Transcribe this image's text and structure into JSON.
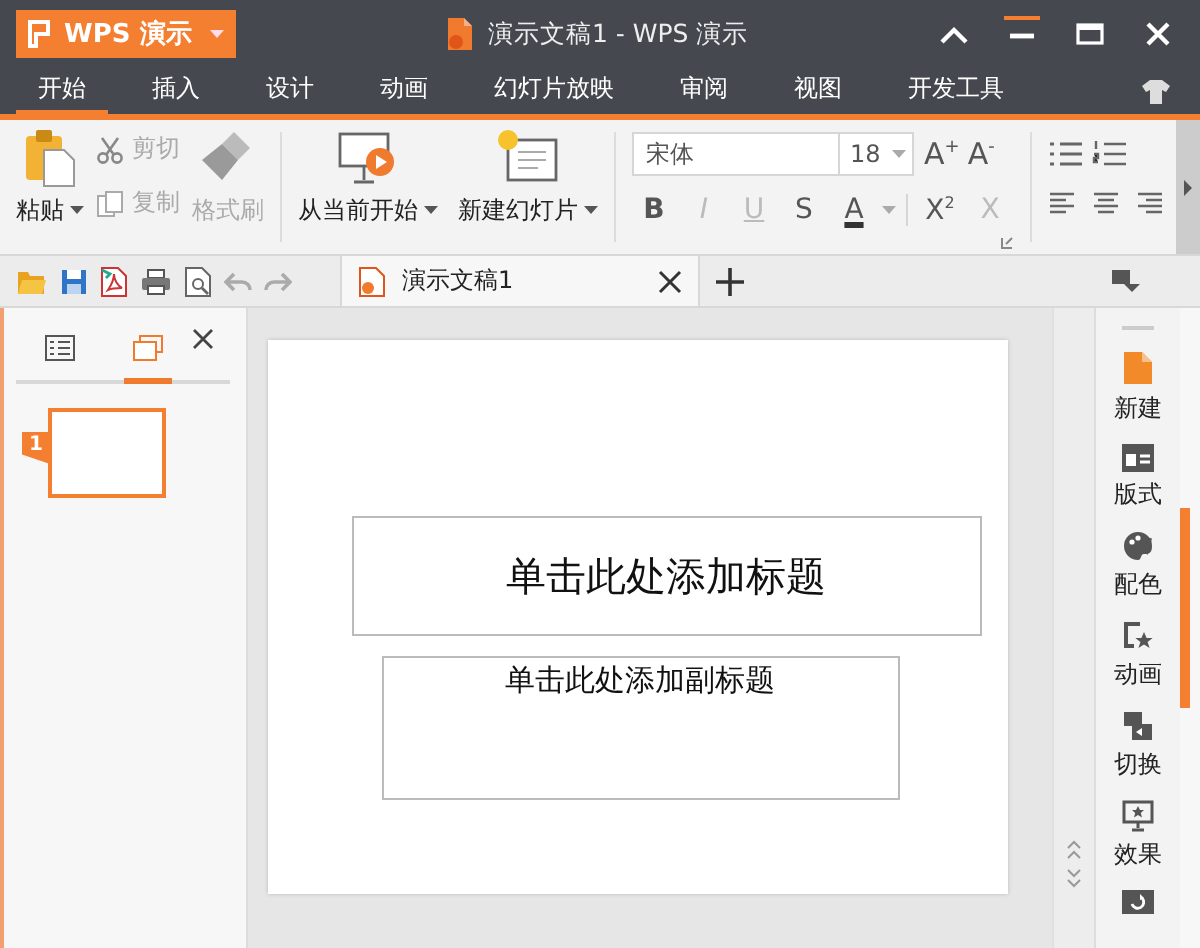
{
  "app_menu": {
    "label": "WPS 演示"
  },
  "window": {
    "title": "演示文稿1 - WPS 演示"
  },
  "menu_tabs": [
    {
      "label": "开始",
      "selected": true
    },
    {
      "label": "插入",
      "selected": false
    },
    {
      "label": "设计",
      "selected": false
    },
    {
      "label": "动画",
      "selected": false
    },
    {
      "label": "幻灯片放映",
      "selected": false
    },
    {
      "label": "审阅",
      "selected": false
    },
    {
      "label": "视图",
      "selected": false
    },
    {
      "label": "开发工具",
      "selected": false
    }
  ],
  "ribbon": {
    "paste": {
      "label": "粘贴",
      "disabled": false
    },
    "small_buttons": [
      {
        "label": "剪切",
        "kind": "cut",
        "disabled": true
      },
      {
        "label": "复制",
        "kind": "copy",
        "disabled": true
      }
    ],
    "format_painter": {
      "label": "格式刷",
      "disabled": true
    },
    "slide_buttons": [
      {
        "label": "从当前开始",
        "kind": "play"
      },
      {
        "label": "新建幻灯片",
        "kind": "new-slide"
      }
    ],
    "font": {
      "value": "宋体"
    },
    "font_size": {
      "value": "18"
    },
    "size_buttons": [
      "A$^{+}$",
      "A$^{-}$"
    ],
    "format_buttons": [
      {
        "label": "B",
        "kind": "bold",
        "disabled": false
      },
      {
        "label": "I",
        "kind": "italic",
        "disabled": true
      },
      {
        "label": "U",
        "kind": "underline",
        "disabled": true
      },
      {
        "label": "S",
        "kind": "shadow",
        "disabled": false
      },
      {
        "label": "A",
        "kind": "color",
        "disabled": false
      },
      {
        "label": "X$^{2}$",
        "kind": "super",
        "disabled": false
      },
      {
        "label": "X",
        "kind": "clear",
        "disabled": true
      }
    ]
  },
  "document_tabs": [
    {
      "label": "演示文稿1",
      "selected": true
    }
  ],
  "slide_panel": {
    "view_tabs": [
      {
        "kind": "outline",
        "selected": false
      },
      {
        "kind": "slides",
        "selected": true
      }
    ],
    "thumbnails": [
      {
        "number": "1",
        "selected": true
      }
    ]
  },
  "slide": {
    "title_placeholder": "单击此处添加标题",
    "subtitle_placeholder": "单击此处添加副标题"
  },
  "task_pane": [
    {
      "label": "新建",
      "kind": "new"
    },
    {
      "label": "版式",
      "kind": "layout"
    },
    {
      "label": "配色",
      "kind": "palette"
    },
    {
      "label": "动画",
      "kind": "animation"
    },
    {
      "label": "切换",
      "kind": "transition"
    },
    {
      "label": "效果",
      "kind": "effect"
    },
    {
      "kind": "rotate"
    }
  ]
}
